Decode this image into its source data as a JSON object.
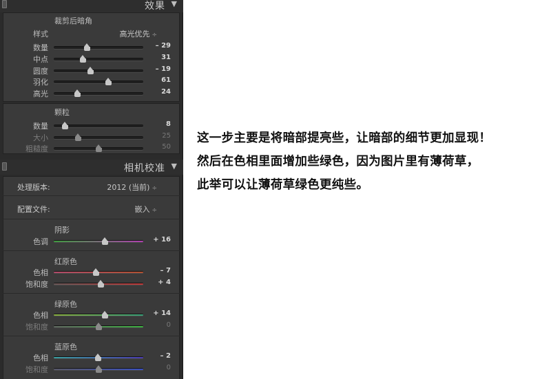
{
  "effects_panel": {
    "header_title": "效果",
    "vignette": {
      "title": "裁剪后暗角",
      "style_label": "样式",
      "style_value": "高光优先",
      "sliders": [
        {
          "label": "数量",
          "value": "– 29",
          "position": 0.37
        },
        {
          "label": "中点",
          "value": "31",
          "position": 0.32
        },
        {
          "label": "圆度",
          "value": "– 19",
          "position": 0.41
        },
        {
          "label": "羽化",
          "value": "61",
          "position": 0.61
        },
        {
          "label": "高光",
          "value": "24",
          "position": 0.26
        }
      ]
    },
    "grain": {
      "title": "颗粒",
      "sliders": [
        {
          "label": "数量",
          "value": "8",
          "position": 0.12
        },
        {
          "label": "大小",
          "value": "25",
          "position": 0.27
        },
        {
          "label": "粗糙度",
          "value": "50",
          "position": 0.5
        }
      ]
    }
  },
  "camera_calibration_panel": {
    "header_title": "相机校准",
    "process_label": "处理版本:",
    "process_value": "2012 (当前)",
    "profile_label": "配置文件:",
    "profile_value": "嵌入",
    "shadows": {
      "title": "阴影",
      "sliders": [
        {
          "label": "色调",
          "value": "+ 16",
          "position": 0.57
        }
      ]
    },
    "red_primary": {
      "title": "红原色",
      "sliders": [
        {
          "label": "色相",
          "value": "– 7",
          "position": 0.47
        },
        {
          "label": "饱和度",
          "value": "+ 4",
          "position": 0.52
        }
      ]
    },
    "green_primary": {
      "title": "绿原色",
      "sliders": [
        {
          "label": "色相",
          "value": "+ 14",
          "position": 0.57
        },
        {
          "label": "饱和度",
          "value": "0",
          "position": 0.5
        }
      ]
    },
    "blue_primary": {
      "title": "蓝原色",
      "sliders": [
        {
          "label": "色相",
          "value": "– 2",
          "position": 0.49
        },
        {
          "label": "饱和度",
          "value": "0",
          "position": 0.5
        }
      ]
    }
  },
  "caption": {
    "line1": "这一步主要是将暗部提亮些，让暗部的细节更加显现！",
    "line2": "然后在色相里面增加些绿色，因为图片里有薄荷草，",
    "line3": "此举可以让薄荷草绿色更纯些。"
  },
  "colors": {
    "panel_bg": "#2b2b2b",
    "section_bg": "#3a3a3a",
    "text": "#bdbdbd",
    "shadow_tint_gradient": [
      "#3e9b3e",
      "#b03fb0"
    ],
    "red_hue_gradient": [
      "#b04a6a",
      "#b05030"
    ],
    "red_sat_gradient": [
      "#6a5858",
      "#c03838"
    ],
    "green_hue_gradient": [
      "#8ab040",
      "#38a078"
    ],
    "green_sat_gradient": [
      "#606860",
      "#3cb040"
    ],
    "blue_hue_gradient": [
      "#3aa0a0",
      "#4a3ab0"
    ],
    "blue_sat_gradient": [
      "#585868",
      "#3a50c0"
    ]
  }
}
